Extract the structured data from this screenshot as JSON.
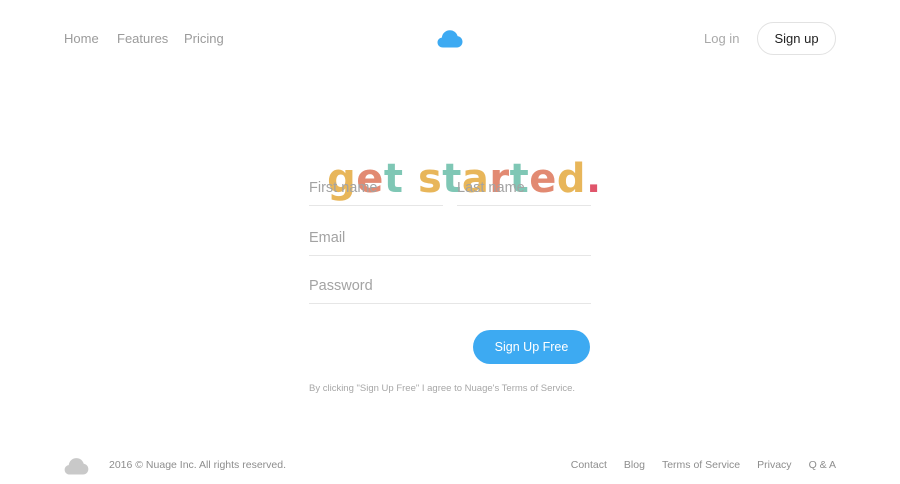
{
  "header": {
    "nav": [
      "Home",
      "Features",
      "Pricing"
    ],
    "login_label": "Log in",
    "signup_label": "Sign up",
    "logo_icon": "cloud-icon",
    "logo_color": "#3daaf2"
  },
  "headline": {
    "letters": [
      {
        "char": "g",
        "color": "#e8b65a"
      },
      {
        "char": "e",
        "color": "#e28a72"
      },
      {
        "char": "t",
        "color": "#7fc7b5"
      },
      {
        "char": " ",
        "color": "#ffffff"
      },
      {
        "char": "s",
        "color": "#e8b65a"
      },
      {
        "char": "t",
        "color": "#7fc7b5"
      },
      {
        "char": "a",
        "color": "#e8b65a"
      },
      {
        "char": "r",
        "color": "#e28a72"
      },
      {
        "char": "t",
        "color": "#7fc7b5"
      },
      {
        "char": "e",
        "color": "#e28a72"
      },
      {
        "char": "d",
        "color": "#e8b65a"
      },
      {
        "char": ".",
        "color": "#e0556b"
      }
    ]
  },
  "form": {
    "first_name_placeholder": "First name",
    "last_name_placeholder": "Last name",
    "email_placeholder": "Email",
    "password_placeholder": "Password",
    "first_name_value": "",
    "last_name_value": "",
    "email_value": "",
    "password_value": "",
    "submit_label": "Sign Up Free",
    "submit_color": "#3daaf2",
    "terms": "By clicking \"Sign Up Free\" I agree to Nuage's Terms of Service."
  },
  "footer": {
    "logo_icon": "cloud-icon",
    "logo_color": "#c9c9c9",
    "copyright": "2016 © Nuage Inc. All rights reserved.",
    "links": [
      "Contact",
      "Blog",
      "Terms of Service",
      "Privacy",
      "Q & A"
    ]
  }
}
